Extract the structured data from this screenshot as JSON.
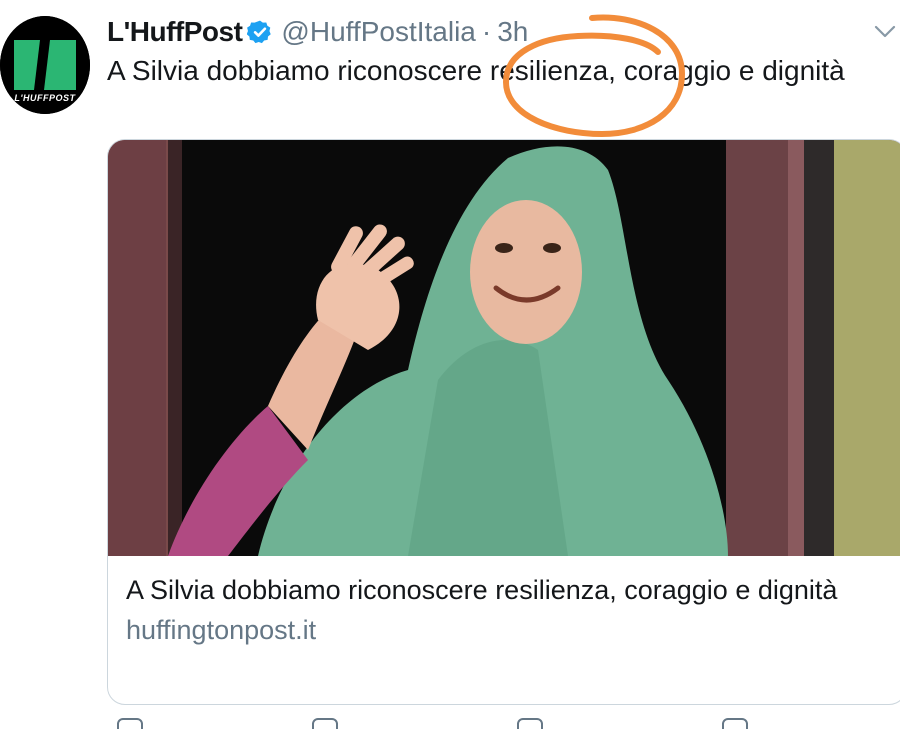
{
  "tweet": {
    "display_name": "L'HuffPost",
    "handle": "@HuffPostItalia",
    "separator": "·",
    "time": "3h",
    "text": "A Silvia dobbiamo riconoscere resilienza, coraggio e dignità",
    "verified": true
  },
  "avatar": {
    "brand_text": "L'HUFFPOST",
    "brand_color": "#2bb673"
  },
  "card": {
    "title": "A Silvia dobbiamo riconoscere resilienza, coraggio e dignità",
    "domain": "huffingtonpost.it",
    "image_description_icon": "photo-image"
  },
  "colors": {
    "text_primary": "#14171a",
    "text_secondary": "#657786",
    "verified_blue": "#1da1f2",
    "annotation_orange": "#f28c3a",
    "card_border": "#ccd6dd"
  },
  "icons": {
    "verified": "verified-badge-icon",
    "menu": "chevron-down-icon"
  }
}
